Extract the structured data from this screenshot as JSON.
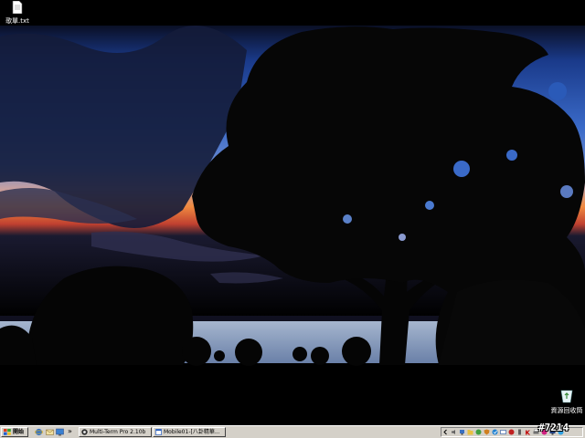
{
  "desktop": {
    "wallpaper": "sunset-tree-silhouette",
    "icons": [
      {
        "label": "歌單.txt",
        "icon": "text-file-icon"
      },
      {
        "label": "資源回收筒",
        "icon": "recycle-bin-icon"
      }
    ]
  },
  "taskbar": {
    "start_label": "開始",
    "quick_launch": [
      "ie-icon",
      "outlook-icon",
      "desktop-icon"
    ],
    "chevron": "»",
    "tasks": [
      {
        "label": "Multi-Term Pro 2.10b",
        "icon": "terminal-icon"
      },
      {
        "label": "Mobile01-[八卦精華...",
        "icon": "browser-icon"
      }
    ],
    "tray_icons": [
      "chevron-left-icon",
      "volume-icon",
      "network-icon",
      "folder-icon",
      "chat-icon",
      "shield-icon",
      "update-icon",
      "mail-icon",
      "antivirus-icon",
      "usb-icon",
      "kaspersky-icon",
      "printer-icon",
      "ime-icon",
      "display-icon",
      "messenger-icon"
    ]
  },
  "watermark": "#7214"
}
